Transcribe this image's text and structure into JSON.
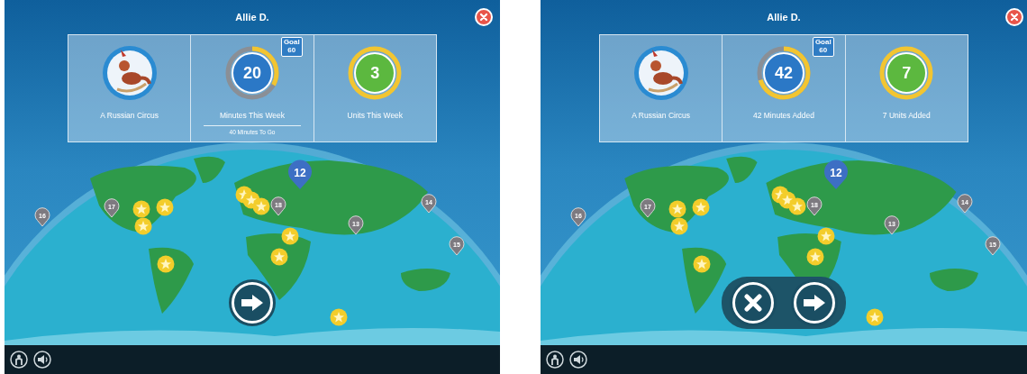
{
  "screens": [
    {
      "title": "Allie D.",
      "cards": [
        {
          "kind": "book",
          "label": "A Russian Circus"
        },
        {
          "kind": "minutes",
          "value": "20",
          "goal_label": "Goal",
          "goal": "60",
          "level": 0.33,
          "label": "Minutes This Week",
          "sublabel": "40 Minutes To Go"
        },
        {
          "kind": "units",
          "value": "3",
          "label": "Units This Week"
        }
      ],
      "current_pin": "12",
      "pins": [
        "16",
        "17",
        "18",
        "13",
        "14",
        "15"
      ],
      "actions": [
        {
          "kind": "next"
        }
      ]
    },
    {
      "title": "Allie D.",
      "cards": [
        {
          "kind": "book",
          "label": "A Russian Circus"
        },
        {
          "kind": "minutes",
          "value": "42",
          "goal_label": "Goal",
          "goal": "60",
          "level": 0.7,
          "label": "42 Minutes Added"
        },
        {
          "kind": "units",
          "value": "7",
          "label": "7 Units Added"
        }
      ],
      "current_pin": "12",
      "pins": [
        "16",
        "17",
        "18",
        "13",
        "14",
        "15"
      ],
      "actions": [
        {
          "kind": "cancel"
        },
        {
          "kind": "next"
        }
      ]
    }
  ]
}
